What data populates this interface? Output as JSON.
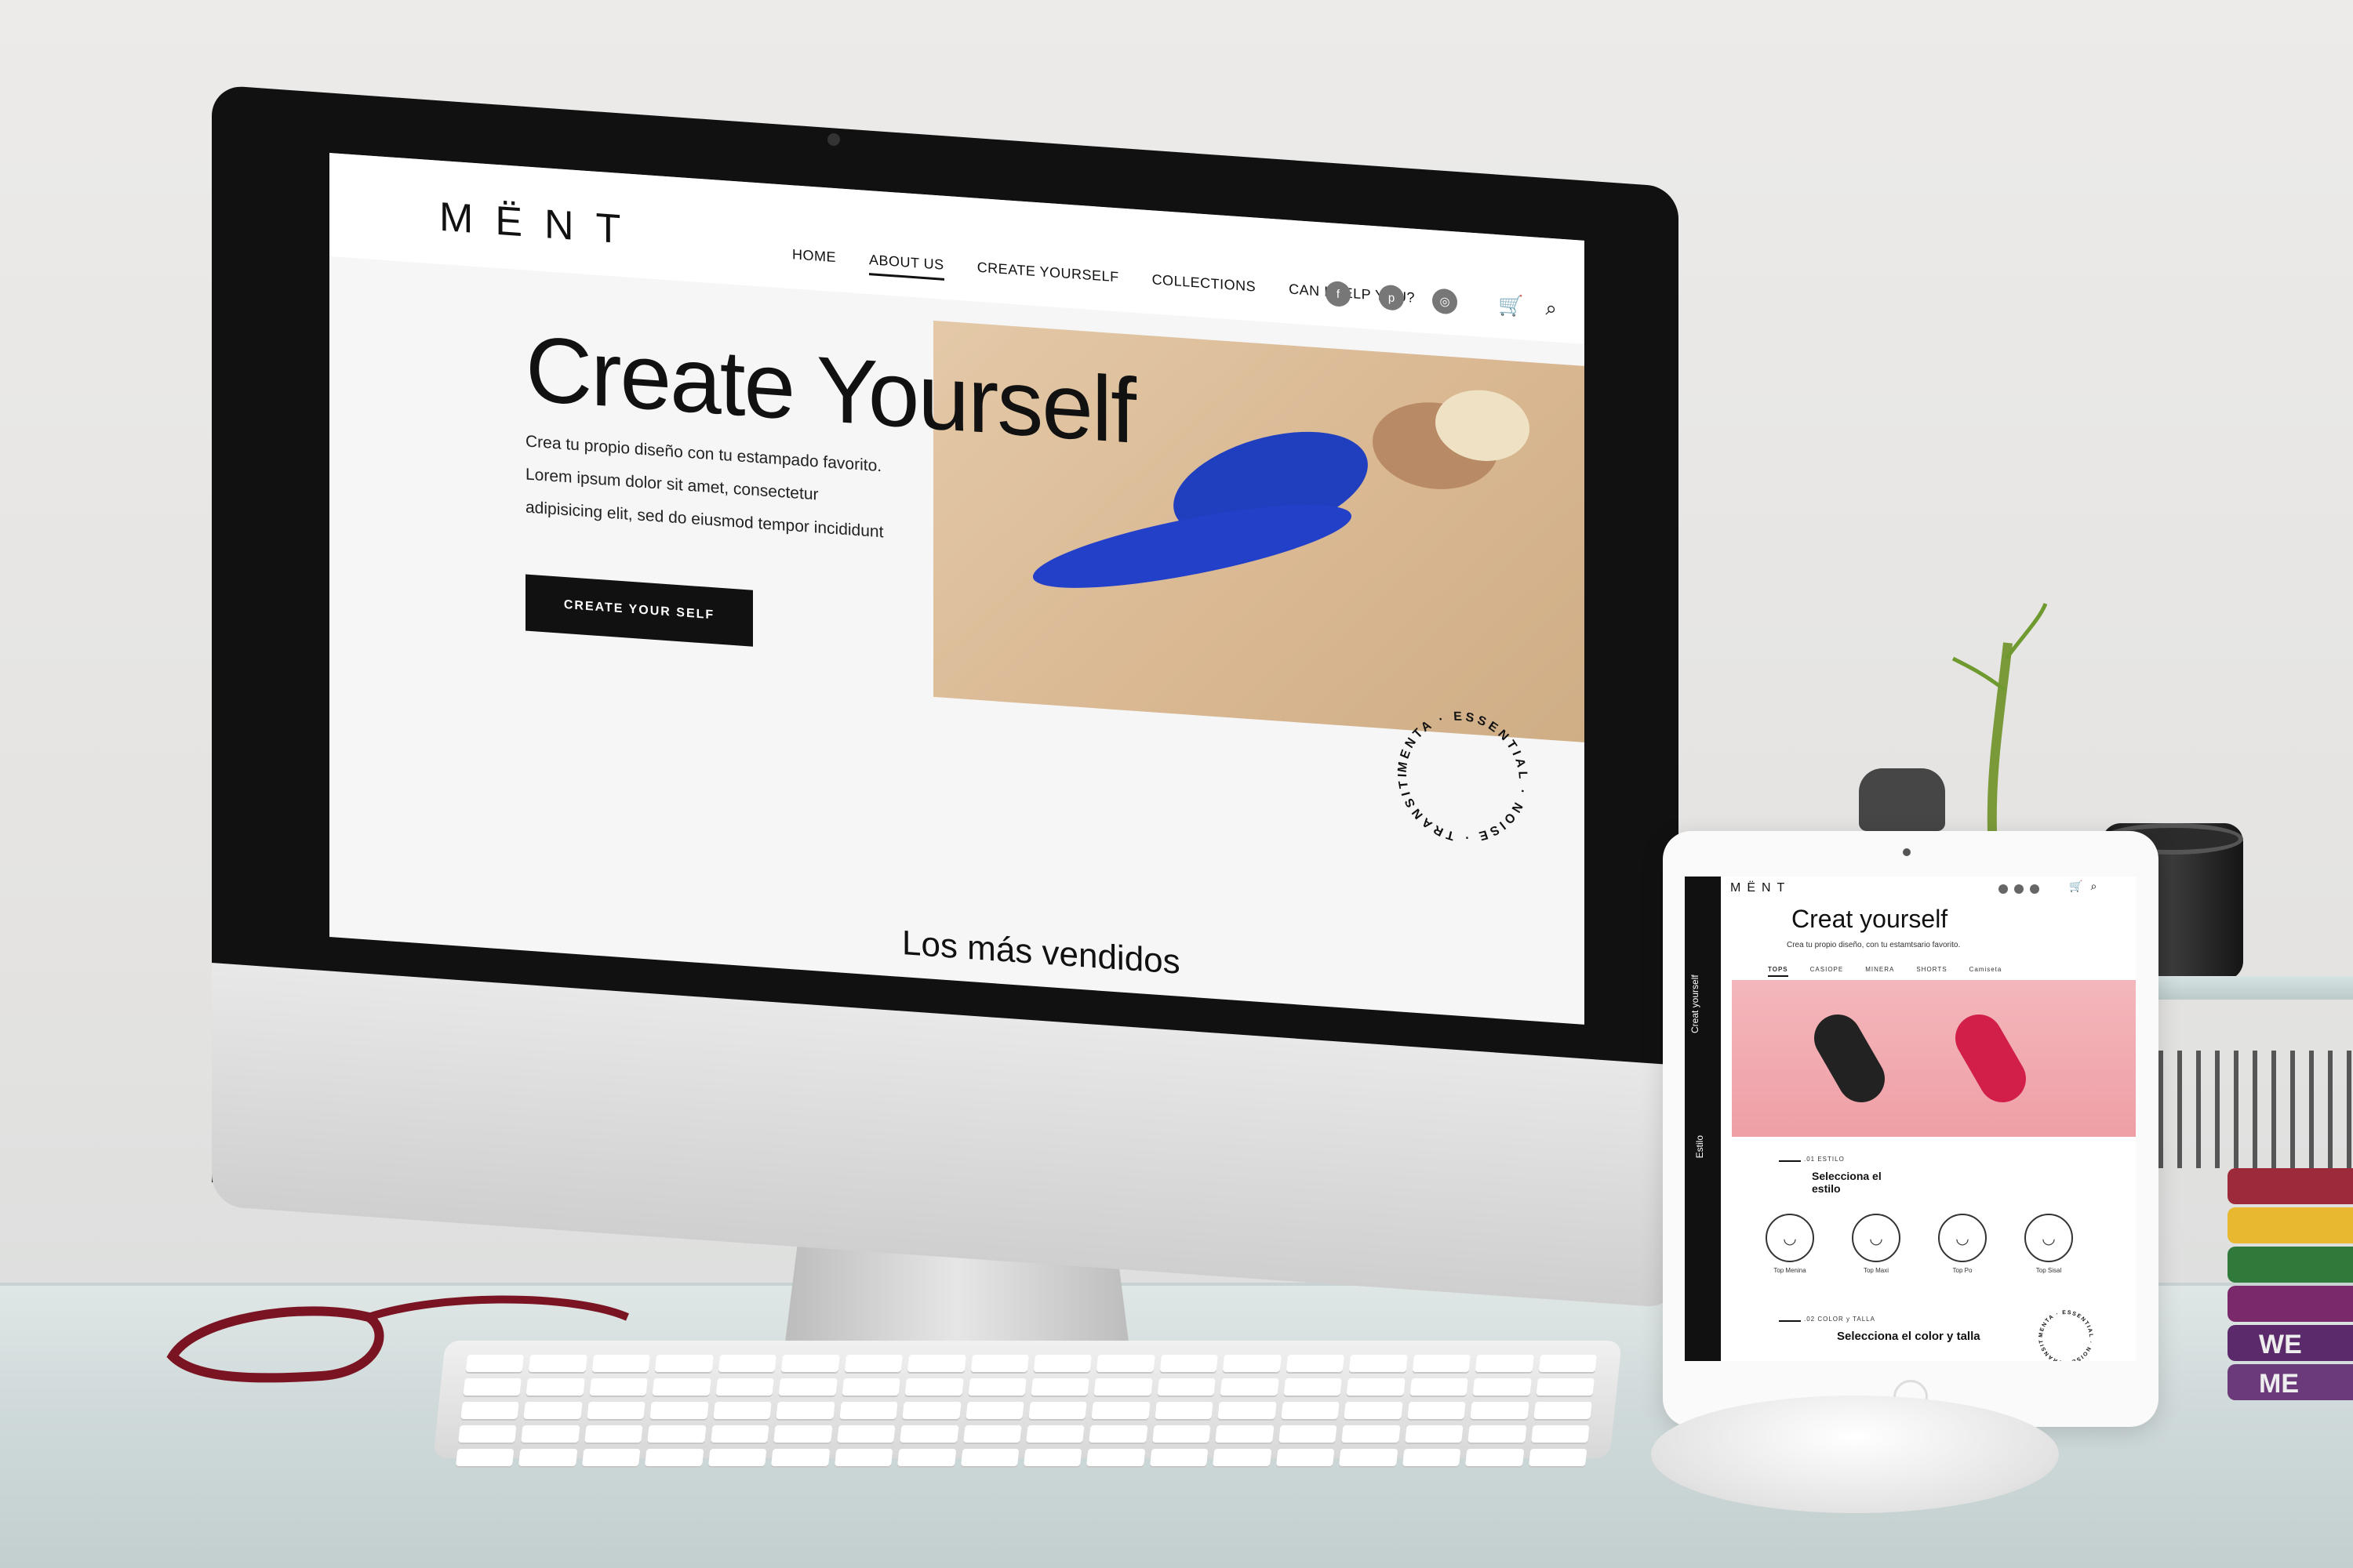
{
  "desktop_site": {
    "logo": "MËNT",
    "nav": [
      {
        "label": "HOME",
        "active": false
      },
      {
        "label": "ABOUT US",
        "active": true
      },
      {
        "label": "CREATE  YOURSELF",
        "active": false
      },
      {
        "label": "COLLECTIONS",
        "active": false
      },
      {
        "label": "CAN I HELP YOU?",
        "active": false
      }
    ],
    "socials": [
      "facebook-icon",
      "pinterest-icon",
      "instagram-icon"
    ],
    "social_glyphs": [
      "f",
      "p",
      "◎"
    ],
    "cart_glyph": "🛒",
    "search_glyph": "⌕",
    "hero": {
      "title": "Create Yourself",
      "line1": "Crea tu propio diseño con tu estampado favorito.",
      "line2": "Lorem ipsum dolor sit amet, consectetur",
      "line3": "adipisicing elit, sed do eiusmod tempor incididunt",
      "cta": "CREATE YOUR SELF"
    },
    "seal_text": "MENTA · ESSENTIAL · NOISE · TRANSITIO ·",
    "section_heading": "Los más vendidos"
  },
  "tablet_site": {
    "logo": "MËNT",
    "side_top": "Creat yourself",
    "side_mid": "Estilo",
    "title": "Creat yourself",
    "subtitle": "Crea tu propio diseño, con tu estamtsario favorito.",
    "tabs": [
      {
        "label": "TOPS",
        "active": true
      },
      {
        "label": "CASIOPE",
        "active": false
      },
      {
        "label": "MINERA",
        "active": false
      },
      {
        "label": "SHORTS",
        "active": false
      },
      {
        "label": "Camiseta",
        "active": false
      }
    ],
    "step1": ".01 ESTILO",
    "step1_title": "Selecciona el estilo",
    "options": [
      {
        "label": "Top Menina",
        "glyph": "◡"
      },
      {
        "label": "Top Maxi",
        "glyph": "◡"
      },
      {
        "label": "Top Po",
        "glyph": "◡"
      },
      {
        "label": "Top Sisal",
        "glyph": "◡"
      }
    ],
    "step2": ".02 COLOR y TALLA",
    "step2_title": "Selecciona el color y talla",
    "seal_text": "MENTA · ESSENTIAL · NOISE · TRANSITIO ·"
  },
  "props": {
    "book_label_1": "WE",
    "book_label_2": "ME"
  },
  "colors": {
    "accent_blue": "#1f3fbf",
    "tablet_photo_pink": "#f0a6ac",
    "hero_photo_sand": "#d9b892"
  }
}
